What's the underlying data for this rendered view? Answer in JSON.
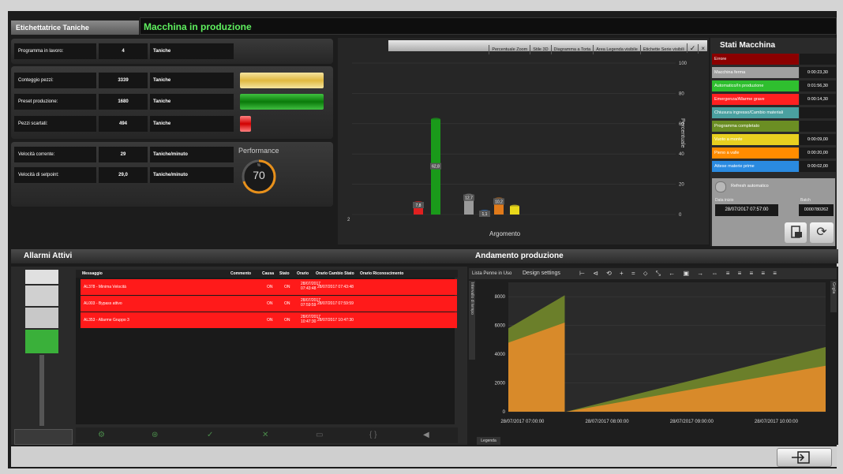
{
  "header": {
    "tab_label": "Etichettatrice Taniche",
    "status_title": "Macchina in produzione"
  },
  "counters": {
    "program": {
      "label": "Programma in lavoro:",
      "value": "4",
      "unit": "Taniche"
    },
    "count": {
      "label": "Conteggio pezzi:",
      "value": "3339",
      "unit": "Taniche"
    },
    "preset": {
      "label": "Preset produzione:",
      "value": "1680",
      "unit": "Taniche"
    },
    "rejected": {
      "label": "Pezzi scartati:",
      "value": "494",
      "unit": "Taniche"
    },
    "speed": {
      "label": "Velocità corrente:",
      "value": "29",
      "unit": "Taniche/minuto"
    },
    "setpoint": {
      "label": "Velocità di setpoint:",
      "value": "29,0",
      "unit": "Taniche/minuto"
    }
  },
  "performance": {
    "title": "Performance",
    "unit": "%",
    "value": "70",
    "fraction": 0.7
  },
  "chart_toolbar": [
    "Percentuale Zoom",
    "Stile 3D",
    "Diagramma a Torta",
    "Area Legenda visibile",
    "Etichette Serie visibili",
    "✓",
    "×"
  ],
  "chart_data": [
    {
      "type": "bar",
      "xlabel": "Argomento",
      "ylabel": "Percentuale",
      "ylim": [
        0,
        100
      ],
      "yticks": [
        "100",
        "80",
        "60",
        "40",
        "20",
        "0"
      ],
      "xtick_left": "2",
      "categories": [
        "Emergenza/Allarme grave",
        "Automatico/In produzione",
        "Macchina ferma",
        "Attese materie prime",
        "Pieno a valle",
        "Vuoto a monte"
      ],
      "values": [
        7.8,
        62.8,
        12.7,
        1.1,
        10.2,
        5.4
      ],
      "value_labels": [
        "7,8",
        "62,8",
        "12,7",
        "1,1",
        "10,2",
        ""
      ],
      "colors": [
        "#e02020",
        "#1a9a1a",
        "#9a9a9a",
        "#2a7ad8",
        "#e07a1a",
        "#e8d81a"
      ]
    },
    {
      "type": "area",
      "title": "Andamento produzione",
      "ylim": [
        0,
        9000
      ],
      "yticks": [
        "8000",
        "6000",
        "4000",
        "2000",
        "0"
      ],
      "xticks": [
        "28/07/2017 07:00:00",
        "28/07/2017 08:00:00",
        "28/07/2017 09:00:00",
        "28/07/2017 10:00:00"
      ],
      "series": [
        {
          "color": "#6b7f2a",
          "x": [
            "28/07/2017 06:50",
            "28/07/2017 07:30",
            "28/07/2017 07:31",
            "28/07/2017 10:35"
          ],
          "values": [
            5800,
            8100,
            0,
            4500
          ]
        },
        {
          "color": "#d88a2a",
          "x": [
            "28/07/2017 06:50",
            "28/07/2017 07:30",
            "28/07/2017 07:31",
            "28/07/2017 10:35"
          ],
          "values": [
            4800,
            6200,
            0,
            3200
          ]
        }
      ]
    }
  ],
  "stati": {
    "title": "Stati Macchina",
    "rows": [
      {
        "label": "Errore",
        "color": "#8b0000",
        "value": ""
      },
      {
        "label": "Macchina ferma",
        "color": "#a0a0a0",
        "value": "0:00:23,30"
      },
      {
        "label": "Automatico/In produzione",
        "color": "#2fbf2f",
        "value": "0:01:56,30"
      },
      {
        "label": "Emergenza/Allarme grave",
        "color": "#ff2020",
        "value": "0:00:14,30"
      },
      {
        "label": "Chiusura ingresso/Cambio materiali",
        "color": "#4aa0a0",
        "value": ""
      },
      {
        "label": "Programma completato",
        "color": "#6b8e23",
        "value": ""
      },
      {
        "label": "Vuoto a monte",
        "color": "#e8d020",
        "value": "0:00:09,00"
      },
      {
        "label": "Pieno a valle",
        "color": "#ff8c00",
        "value": "0:00:20,00"
      },
      {
        "label": "Attese materie prime",
        "color": "#2a8ae0",
        "value": "0:00:02,00"
      }
    ],
    "refresh_label": "Refresh automatico",
    "date_label": "Data inizio",
    "batch_label": "Batch",
    "date_value": "28/07/2017 07:57:00",
    "batch_value": "0000780262"
  },
  "alarms": {
    "title": "Allarmi Attivi",
    "columns": [
      "Messaggio",
      "Commento",
      "Causa",
      "Stato",
      "Orario",
      "Orario Cambio Stato",
      "Orario Riconoscimento"
    ],
    "rows": [
      {
        "msg": "AL378 - Minima Velocità",
        "causa": "ON",
        "stato": "ON",
        "orario": "28/07/2017 07:43:48",
        "cambio": "28/07/2017 07:43:48",
        "ric": ""
      },
      {
        "msg": "AL003 - Bypass attivo",
        "causa": "ON",
        "stato": "ON",
        "orario": "28/07/2017 07:59:59",
        "cambio": "28/07/2017 07:59:59",
        "ric": ""
      },
      {
        "msg": "AL353 - Allarme Gruppo 3",
        "causa": "ON",
        "stato": "ON",
        "orario": "28/07/2017 10:47:30",
        "cambio": "28/07/2017 10:47:30",
        "ric": ""
      }
    ]
  },
  "production": {
    "title": "Andamento produzione",
    "pen_label": "Lista Penne in Uso",
    "design_label": "Design settings",
    "side_label": "Intervallo di tempo",
    "right_label": "Griglia",
    "legend_label": "Legenda"
  }
}
